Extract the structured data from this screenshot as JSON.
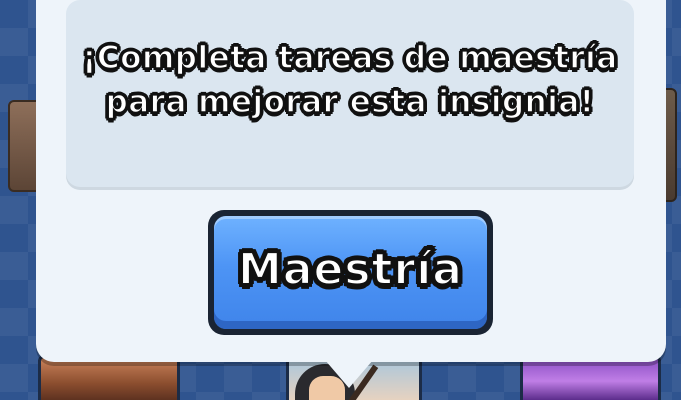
{
  "tooltip": {
    "message": "¡Completa tareas de maestría para mejorar esta insignia!"
  },
  "mastery_button": {
    "label": "Maestría"
  },
  "colors": {
    "background": "#2f548f",
    "panel": "#eef4fa",
    "message_box": "#dbe6f0",
    "button": "#4d94f5",
    "text_outline": "#111111"
  },
  "icons": {
    "deck_cards": [
      "card-art-1-icon",
      "card-art-2-icon",
      "card-art-3-icon"
    ]
  }
}
